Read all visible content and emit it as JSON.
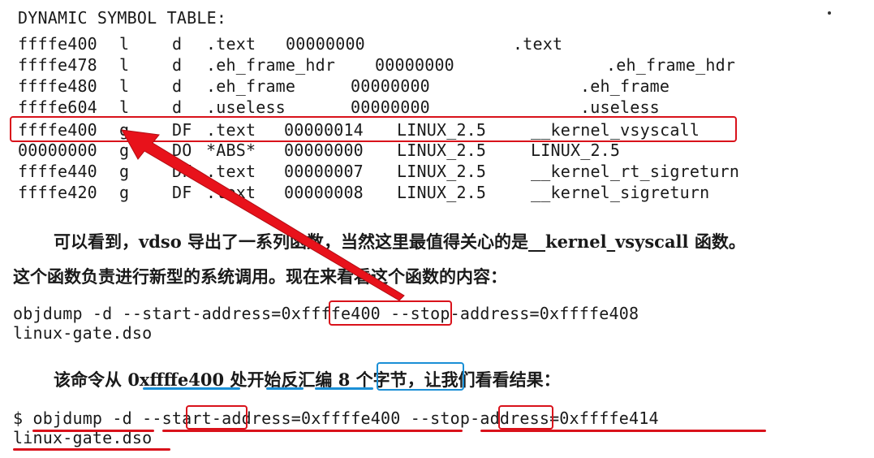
{
  "symtab": {
    "title": "DYNAMIC SYMBOL TABLE:",
    "rows": [
      {
        "addr": "ffffe400",
        "scope": "l",
        "flag": "d",
        "section": ".text",
        "size": "00000000",
        "version": "",
        "name": ".text"
      },
      {
        "addr": "ffffe478",
        "scope": "l",
        "flag": "d",
        "section": ".eh_frame_hdr",
        "size": "00000000",
        "version": "",
        "name": ".eh_frame_hdr"
      },
      {
        "addr": "ffffe480",
        "scope": "l",
        "flag": "d",
        "section": ".eh_frame",
        "size": "00000000",
        "version": "",
        "name": ".eh_frame"
      },
      {
        "addr": "ffffe604",
        "scope": "l",
        "flag": "d",
        "section": ".useless",
        "size": "00000000",
        "version": "",
        "name": ".useless"
      },
      {
        "addr": "ffffe400",
        "scope": "g",
        "flag": "DF",
        "section": ".text",
        "size": "00000014",
        "version": "LINUX_2.5",
        "name": "__kernel_vsyscall"
      },
      {
        "addr": "00000000",
        "scope": "g",
        "flag": "DO",
        "section": "*ABS*",
        "size": "00000000",
        "version": "LINUX_2.5",
        "name": "LINUX_2.5"
      },
      {
        "addr": "ffffe440",
        "scope": "g",
        "flag": "DF",
        "section": ".text",
        "size": "00000007",
        "version": "LINUX_2.5",
        "name": "__kernel_rt_sigreturn"
      },
      {
        "addr": "ffffe420",
        "scope": "g",
        "flag": "DF",
        "section": ".text",
        "size": "00000008",
        "version": "LINUX_2.5",
        "name": "__kernel_sigreturn"
      }
    ]
  },
  "para1": {
    "line1": "可以看到，vdso 导出了一系列函数，当然这里最值得关心的是__kernel_vsyscall 函数。",
    "line2": "这个函数负责进行新型的系统调用。现在来看看这个函数的内容："
  },
  "cmd1": {
    "prefix": "objdump -d --start-address=",
    "addr": "0xffffe400",
    "suffix": " --stop-address=0xffffe408",
    "line2": "linux-gate.dso"
  },
  "para2": {
    "a": "该命令从 ",
    "addr": "0xffffe400",
    "b": " 处",
    "kaishi": "开始",
    "fanhuibian": "反汇编",
    "bytes": "8 个字节",
    "c": "，让我们看看结果："
  },
  "cmd2": {
    "prompt": "$ ",
    "objdump": "objdump -d",
    "dashes1": " --",
    "start": "start",
    "mid": "-address=0xffffe400 ",
    "dashes2": "--",
    "stop": "stop",
    "end": "-address=0xffffe414",
    "line2": "linux-gate.dso"
  },
  "colors": {
    "annotation_red": "#d9121b",
    "annotation_blue": "#1a8fd6"
  }
}
